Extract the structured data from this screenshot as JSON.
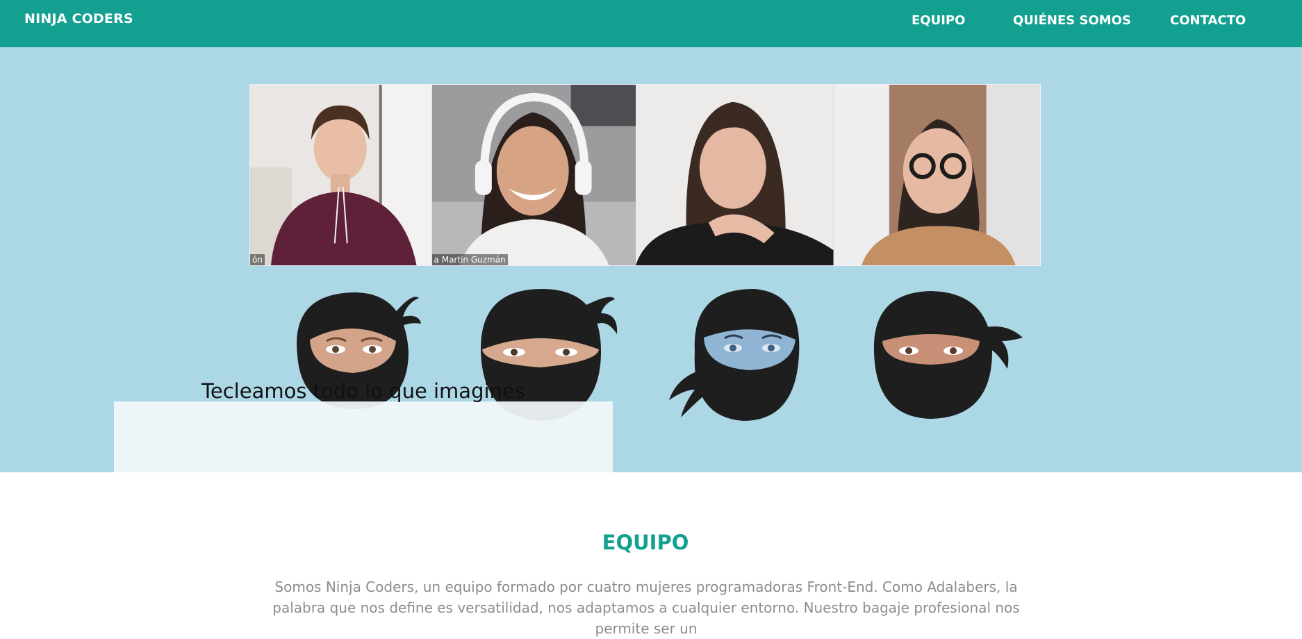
{
  "header": {
    "brand": "NINJA CODERS",
    "nav": [
      {
        "label": "EQUIPO"
      },
      {
        "label": "QUIÉNES SOMOS"
      },
      {
        "label": "CONTACTO"
      }
    ]
  },
  "hero": {
    "photo_captions": [
      "ón",
      "a Martín Guzmán"
    ],
    "tagline": "Tecleamos todo lo que imagines"
  },
  "equipo": {
    "title": "EQUIPO",
    "text": "Somos Ninja Coders, un equipo formado por cuatro mujeres programadoras Front-End. Como Adalabers, la palabra que nos define es versatilidad, nos adaptamos a cualquier entorno. Nuestro bagaje profesional nos permite ser un"
  },
  "colors": {
    "brand_teal": "#13a090",
    "hero_blue": "#acd7e5",
    "ninja_black": "#1e1e1e"
  }
}
